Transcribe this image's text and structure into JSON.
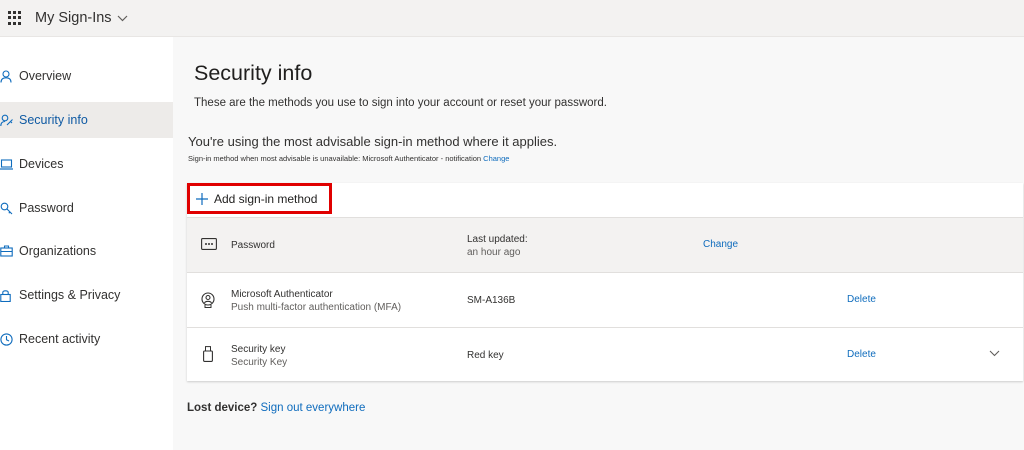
{
  "app": {
    "title": "My Sign-Ins"
  },
  "sidebar": {
    "items": [
      {
        "label": "Overview",
        "icon": "person-icon"
      },
      {
        "label": "Security info",
        "icon": "person-key-icon"
      },
      {
        "label": "Devices",
        "icon": "laptop-icon"
      },
      {
        "label": "Password",
        "icon": "key-icon"
      },
      {
        "label": "Organizations",
        "icon": "briefcase-icon"
      },
      {
        "label": "Settings & Privacy",
        "icon": "lock-icon"
      },
      {
        "label": "Recent activity",
        "icon": "clock-icon"
      }
    ],
    "active_index": 1
  },
  "main": {
    "title": "Security info",
    "description": "These are the methods you use to sign into your account or reset your password.",
    "advisable": "You're using the most advisable sign-in method where it applies.",
    "advisable_sub": "Sign-in method when most advisable is unavailable: Microsoft Authenticator - notification",
    "advisable_change": "Change",
    "add_method": "Add sign-in method",
    "methods": [
      {
        "name": "Password",
        "sub": "",
        "detail_label": "Last updated:",
        "detail": "an hour ago",
        "action": "Change",
        "icon": "password-dots-icon"
      },
      {
        "name": "Microsoft Authenticator",
        "sub": "Push multi-factor authentication (MFA)",
        "detail_label": "",
        "detail": "SM-A136B",
        "action": "Delete",
        "icon": "authenticator-icon"
      },
      {
        "name": "Security key",
        "sub": "Security Key",
        "detail_label": "",
        "detail": "Red key",
        "action": "Delete",
        "icon": "usb-key-icon"
      }
    ],
    "lost_device": "Lost device?",
    "sign_out": "Sign out everywhere"
  },
  "colors": {
    "accent": "#0f6cbd",
    "active_nav_bg": "#edebe9",
    "highlight_border": "#e00000"
  }
}
